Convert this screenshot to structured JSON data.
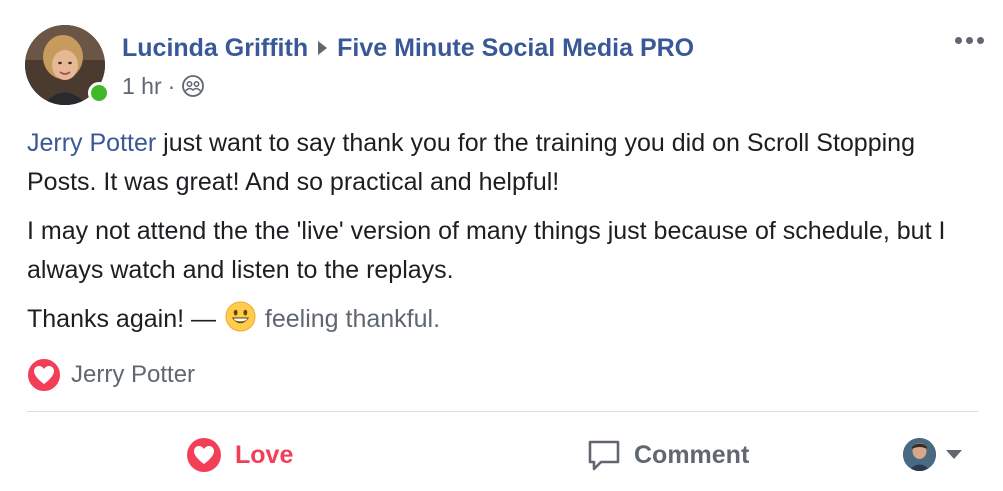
{
  "header": {
    "author": "Lucinda Griffith",
    "group": "Five Minute Social Media PRO",
    "timestamp": "1 hr",
    "separator": "·",
    "audience_icon": "group-icon",
    "more_icon": "more-options-icon"
  },
  "body": {
    "mention": "Jerry Potter",
    "paragraph1_rest": " just want to say thank you for the training you did on Scroll Stopping Posts. It was great! And so practical and helpful!",
    "paragraph2": "I may not attend the the 'live' version of many things just because of schedule, but I always watch and listen to the replays.",
    "paragraph3_prefix": "Thanks again! —",
    "feeling_icon": "grinning-emoji-icon",
    "feeling": "feeling thankful."
  },
  "reactions": {
    "icon": "love-reaction-icon",
    "names": "Jerry Potter"
  },
  "actions": {
    "love_label": "Love",
    "comment_label": "Comment"
  },
  "colors": {
    "link": "#385898",
    "love": "#f33e58",
    "online": "#42b72a",
    "secondary_text": "#606770",
    "divider": "#dadde1"
  }
}
